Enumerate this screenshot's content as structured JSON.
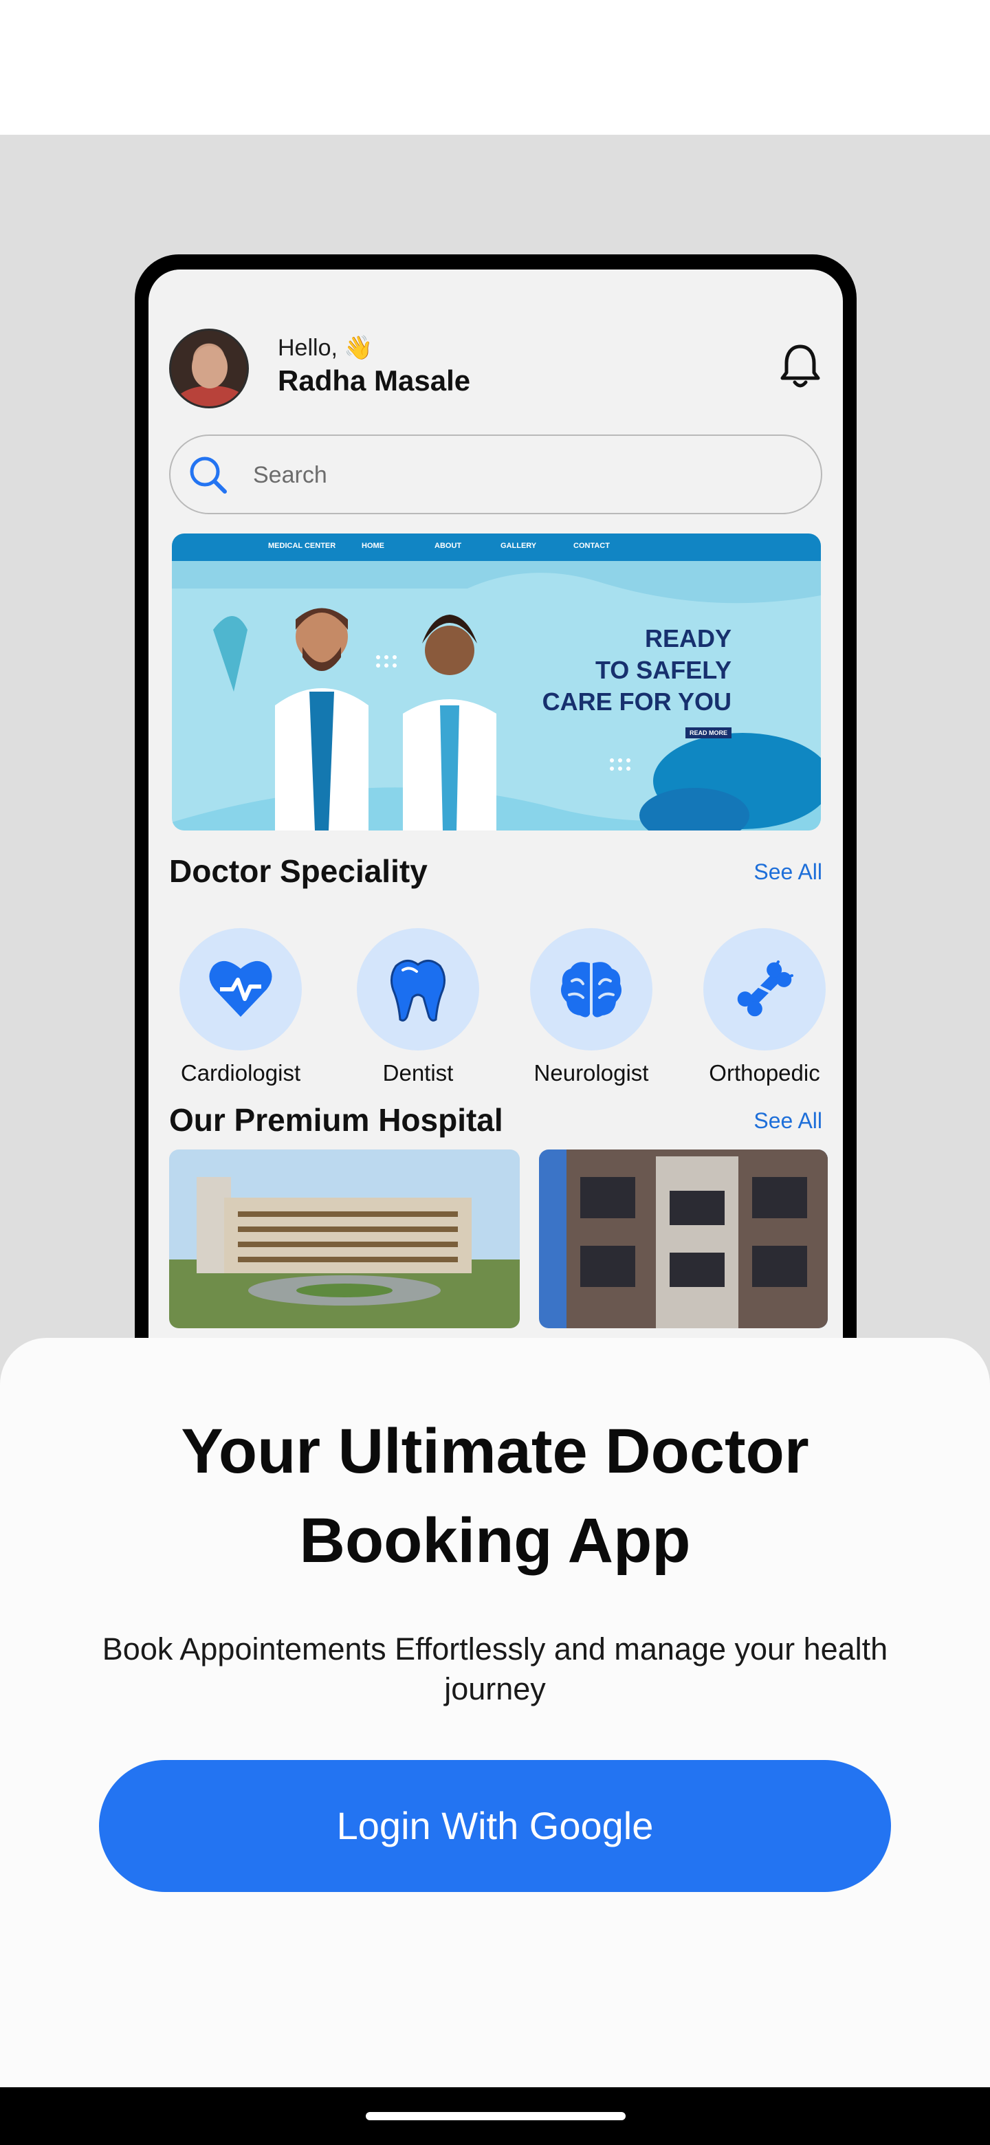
{
  "preview": {
    "greeting": "Hello,",
    "greeting_emoji": "👋",
    "user_name": "Radha Masale",
    "search_placeholder": "Search",
    "banner": {
      "brand": "MEDICAL CENTER",
      "nav": [
        "HOME",
        "ABOUT",
        "GALLERY",
        "CONTACT"
      ],
      "headline_lines": [
        "READY",
        "TO SAFELY",
        "CARE FOR YOU"
      ],
      "cta": "READ MORE"
    },
    "speciality_title": "Doctor Speciality",
    "speciality_see_all": "See All",
    "specialities": [
      {
        "label": "Cardiologist",
        "icon": "heart-pulse-icon"
      },
      {
        "label": "Dentist",
        "icon": "tooth-icon"
      },
      {
        "label": "Neurologist",
        "icon": "brain-icon"
      },
      {
        "label": "Orthopedic",
        "icon": "bone-icon"
      }
    ],
    "hospital_title": "Our Premium Hospital",
    "hospital_see_all": "See All"
  },
  "onboarding": {
    "title_line1": "Your Ultimate Doctor",
    "title_line2": "Booking App",
    "subtitle": "Book Appointements Effortlessly and manage your health journey",
    "login_button": "Login With Google"
  },
  "colors": {
    "accent": "#2374f2",
    "speciality_bg": "#d4e5fb",
    "icon_blue": "#1b6ff0",
    "link": "#1e6fd9"
  }
}
